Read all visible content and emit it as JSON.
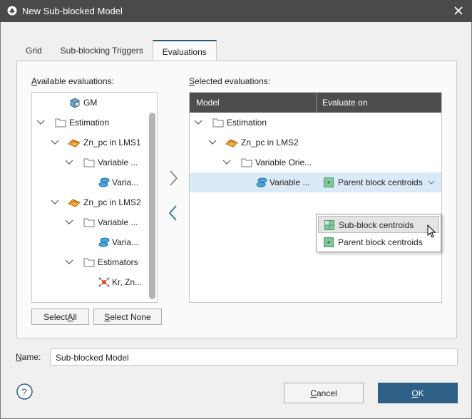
{
  "window": {
    "title": "New Sub-blocked Model"
  },
  "tabs": [
    {
      "label": "Grid",
      "active": false
    },
    {
      "label": "Sub-blocking Triggers",
      "active": false
    },
    {
      "label": "Evaluations",
      "active": true
    }
  ],
  "available": {
    "label_prefix": "A",
    "label_rest": "vailable evaluations:",
    "items": [
      {
        "text": "GM",
        "icon": "block-model-icon",
        "expandable": false
      },
      {
        "text": "Estimation",
        "icon": "folder-icon",
        "expandable": true
      },
      {
        "text": "Zn_pc in LMS1",
        "icon": "surface-icon",
        "expandable": true
      },
      {
        "text": "Variable ...",
        "icon": "folder-icon",
        "expandable": true
      },
      {
        "text": "Varia...",
        "icon": "variable-orientation-icon",
        "expandable": false
      },
      {
        "text": "Zn_pc in LMS2",
        "icon": "surface-icon",
        "expandable": true
      },
      {
        "text": "Variable ...",
        "icon": "folder-icon",
        "expandable": true
      },
      {
        "text": "Varia...",
        "icon": "variable-orientation-icon",
        "expandable": false
      },
      {
        "text": "Estimators",
        "icon": "folder-icon",
        "expandable": true
      },
      {
        "text": "Kr, Zn...",
        "icon": "kriging-icon",
        "expandable": false
      }
    ],
    "select_all_pre": "Select ",
    "select_all_key": "A",
    "select_all_post": "ll",
    "select_none_key": "S",
    "select_none_post": "elect None"
  },
  "selected": {
    "label_prefix": "S",
    "label_rest": "elected evaluations:",
    "col_model": "Model",
    "col_evaluate": "Evaluate on",
    "items": [
      {
        "text": "Estimation",
        "icon": "folder-icon"
      },
      {
        "text": "Zn_pc in LMS2",
        "icon": "surface-icon"
      },
      {
        "text": "Variable Orie...",
        "icon": "folder-icon"
      },
      {
        "text": "Variable ...",
        "icon": "variable-orientation-icon",
        "evaluate_on": "Parent block centroids"
      }
    ]
  },
  "dropdown": {
    "options": [
      {
        "label": "Sub-block centroids",
        "icon": "sub-block-centroids-icon",
        "highlighted": true
      },
      {
        "label": "Parent block centroids",
        "icon": "parent-block-centroids-icon",
        "highlighted": false
      }
    ]
  },
  "name": {
    "label_key": "N",
    "label_rest": "ame:",
    "value": "Sub-blocked Model"
  },
  "footer": {
    "help": "?",
    "cancel_key": "C",
    "cancel_rest": "ancel",
    "ok_key": "O",
    "ok_rest": "K"
  },
  "colors": {
    "titlebar": "#4a4a4a",
    "header": "#4d4d4d",
    "accent": "#2e5f86",
    "selection": "#dbeaf7"
  }
}
